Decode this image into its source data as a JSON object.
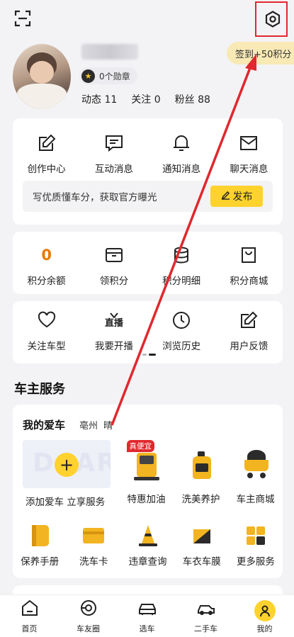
{
  "header": {
    "checkin_label": "签到+50积分"
  },
  "profile": {
    "badge_text": "0个勋章",
    "stats": [
      {
        "label": "动态",
        "value": "11"
      },
      {
        "label": "关注",
        "value": "0"
      },
      {
        "label": "粉丝",
        "value": "88"
      }
    ]
  },
  "creator": {
    "items": [
      {
        "label": "创作中心",
        "icon": "edit-icon"
      },
      {
        "label": "互动消息",
        "icon": "comment-icon"
      },
      {
        "label": "通知消息",
        "icon": "bell-icon"
      },
      {
        "label": "聊天消息",
        "icon": "mail-icon"
      }
    ],
    "banner_text": "写优质懂车分，获取官方曝光",
    "publish_label": "发布"
  },
  "points": {
    "items": [
      {
        "label": "积分余额",
        "value": "0"
      },
      {
        "label": "领积分",
        "icon": "box-icon"
      },
      {
        "label": "积分明细",
        "icon": "coins-icon"
      },
      {
        "label": "积分商城",
        "icon": "bag-icon"
      }
    ]
  },
  "tools": {
    "items": [
      {
        "label": "关注车型",
        "icon": "heart-icon"
      },
      {
        "label": "我要开播",
        "icon": "live-icon",
        "glyph": "直播"
      },
      {
        "label": "浏览历史",
        "icon": "clock-icon"
      },
      {
        "label": "用户反馈",
        "icon": "feedback-icon"
      }
    ]
  },
  "owner_services": {
    "title": "车主服务",
    "my_car_title": "我的爱车",
    "city": "亳州",
    "weather": "晴",
    "add_car_label": "添加爱车 立享服务",
    "add_car_watermark": "DCAR",
    "services_row1": [
      {
        "label": "特惠加油",
        "icon": "fuel-pump-icon",
        "tag": "真便宜"
      },
      {
        "label": "洗美养护",
        "icon": "oil-bottle-icon"
      },
      {
        "label": "车主商城",
        "icon": "cart-icon"
      }
    ],
    "services_row2": [
      {
        "label": "保养手册",
        "icon": "manual-icon"
      },
      {
        "label": "洗车卡",
        "icon": "card-icon"
      },
      {
        "label": "违章查询",
        "icon": "cone-icon"
      },
      {
        "label": "车衣车膜",
        "icon": "film-icon"
      },
      {
        "label": "更多服务",
        "icon": "grid-icon"
      }
    ]
  },
  "tabbar": {
    "tabs": [
      {
        "label": "首页",
        "icon": "home-icon"
      },
      {
        "label": "车友圈",
        "icon": "circle-icon"
      },
      {
        "label": "选车",
        "icon": "car-icon"
      },
      {
        "label": "二手车",
        "icon": "used-car-icon"
      },
      {
        "label": "我的",
        "icon": "profile-icon"
      }
    ]
  },
  "colors": {
    "accent": "#ffd22e",
    "points_orange": "#e87a00",
    "annotation_red": "#e0282e"
  }
}
